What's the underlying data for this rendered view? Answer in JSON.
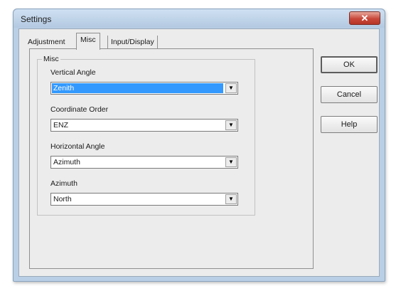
{
  "window": {
    "title": "Settings",
    "close_label": "✕"
  },
  "tabs": [
    {
      "label": "Adjustment"
    },
    {
      "label": "Misc"
    },
    {
      "label": "Input/Display"
    }
  ],
  "misc": {
    "group_title": "Misc",
    "fields": [
      {
        "label": "Vertical Angle",
        "value": "Zenith"
      },
      {
        "label": "Coordinate Order",
        "value": "ENZ"
      },
      {
        "label": "Horizontal Angle",
        "value": "Azimuth"
      },
      {
        "label": "Azimuth",
        "value": "North"
      }
    ]
  },
  "buttons": {
    "ok": "OK",
    "cancel": "Cancel",
    "help": "Help"
  },
  "icons": {
    "dropdown_arrow": "▼"
  }
}
